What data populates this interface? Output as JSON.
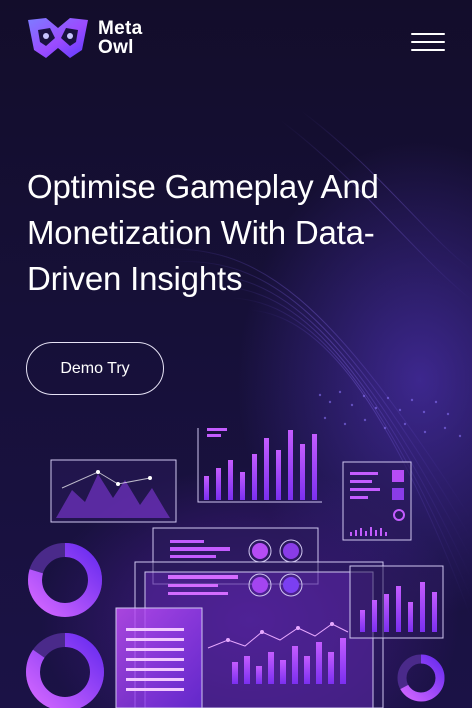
{
  "brand": {
    "name_line1": "Meta",
    "name_line2": "Owl"
  },
  "hero": {
    "title": "Optimise Gameplay And Monetization With Data-Driven Insights",
    "cta_label": "Demo Try"
  },
  "colors": {
    "background": "#120c2c",
    "accent_purple": "#a445f0",
    "accent_violet": "#7b3ff2",
    "panel_border": "#cfc6ef"
  },
  "icons": {
    "logo": "owl-mask-logo-icon",
    "menu": "hamburger-menu-icon"
  }
}
